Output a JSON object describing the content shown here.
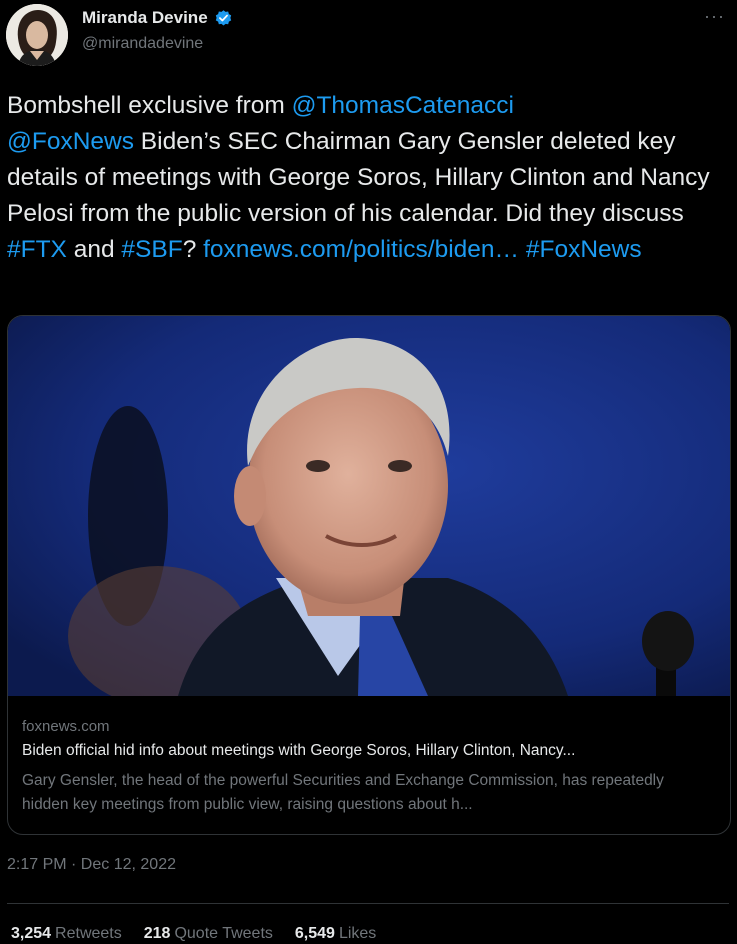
{
  "author": {
    "display_name": "Miranda Devine",
    "handle": "@mirandadevine",
    "avatar_icon": "profile-photo",
    "verified_icon": "verified-badge-icon"
  },
  "more_icon": "more-options-icon",
  "tweet": {
    "segments": [
      {
        "text": "Bombshell exclusive from ",
        "link": false
      },
      {
        "text": "@ThomasCatenacci",
        "link": true
      },
      {
        "text": "\n",
        "link": false
      },
      {
        "text": "@FoxNews",
        "link": true
      },
      {
        "text": " Biden’s SEC Chairman Gary Gensler deleted key details of meetings with George Soros, Hillary Clinton and Nancy Pelosi from the public version of his calendar. Did they discuss ",
        "link": false
      },
      {
        "text": "#FTX",
        "link": true
      },
      {
        "text": " and ",
        "link": false
      },
      {
        "text": "#SBF",
        "link": true
      },
      {
        "text": "? ",
        "link": false
      },
      {
        "text": "foxnews.com/politics/biden…",
        "link": true
      },
      {
        "text": " ",
        "link": false
      },
      {
        "text": "#FoxNews",
        "link": true
      }
    ]
  },
  "card": {
    "domain": "foxnews.com",
    "title": "Biden official hid info about meetings with George Soros, Hillary Clinton, Nancy...",
    "description": "Gary Gensler, the head of the powerful Securities and Exchange Commission, has repeatedly hidden key meetings from public view, raising questions about h..."
  },
  "timestamp": "2:17 PM · Dec 12, 2022",
  "stats": {
    "retweets_count": "3,254",
    "retweets_label": "Retweets",
    "quotes_count": "218",
    "quotes_label": "Quote Tweets",
    "likes_count": "6,549",
    "likes_label": "Likes"
  },
  "colors": {
    "background": "#000000",
    "text": "#e7e9ea",
    "secondary": "#71767b",
    "link": "#1d9bf0",
    "border": "#2f3336"
  }
}
